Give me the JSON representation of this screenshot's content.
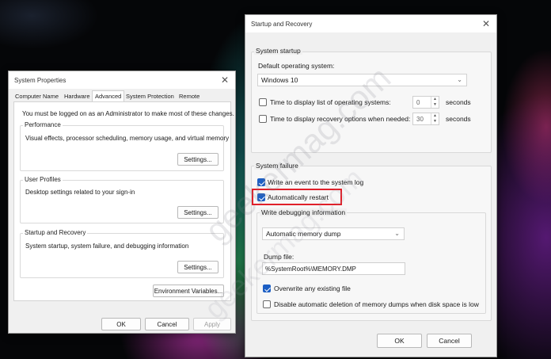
{
  "system_properties": {
    "title": "System Properties",
    "tabs": [
      "Computer Name",
      "Hardware",
      "Advanced",
      "System Protection",
      "Remote"
    ],
    "active_tab": "Advanced",
    "admin_note": "You must be logged on as an Administrator to make most of these changes.",
    "performance": {
      "label": "Performance",
      "desc": "Visual effects, processor scheduling, memory usage, and virtual memory",
      "button": "Settings..."
    },
    "user_profiles": {
      "label": "User Profiles",
      "desc": "Desktop settings related to your sign-in",
      "button": "Settings..."
    },
    "startup_recovery": {
      "label": "Startup and Recovery",
      "desc": "System startup, system failure, and debugging information",
      "button": "Settings..."
    },
    "env_button": "Environment Variables...",
    "ok": "OK",
    "cancel": "Cancel",
    "apply": "Apply"
  },
  "startup_recovery_dialog": {
    "title": "Startup and Recovery",
    "system_startup": {
      "label": "System startup",
      "default_os_label": "Default operating system:",
      "default_os_value": "Windows 10",
      "time_list_label": "Time to display list of operating systems:",
      "time_list_checked": false,
      "time_list_value": "0",
      "time_recovery_label": "Time to display recovery options when needed:",
      "time_recovery_checked": false,
      "time_recovery_value": "30",
      "seconds": "seconds"
    },
    "system_failure": {
      "label": "System failure",
      "write_event_label": "Write an event to the system log",
      "write_event_checked": true,
      "auto_restart_label": "Automatically restart",
      "auto_restart_checked": true,
      "debug_label": "Write debugging information",
      "debug_value": "Automatic memory dump",
      "dump_file_label": "Dump file:",
      "dump_file_value": "%SystemRoot%\\MEMORY.DMP",
      "overwrite_label": "Overwrite any existing file",
      "overwrite_checked": true,
      "disable_auto_delete_label": "Disable automatic deletion of memory dumps when disk space is low",
      "disable_auto_delete_checked": false
    },
    "ok": "OK",
    "cancel": "Cancel"
  },
  "watermark": "geekermag.com",
  "colors": {
    "accent": "#1d5fc4",
    "highlight": "#e0202a"
  },
  "icons": [
    "close-icon",
    "chevron-down-icon",
    "spin-up-icon",
    "spin-down-icon",
    "check-icon"
  ]
}
